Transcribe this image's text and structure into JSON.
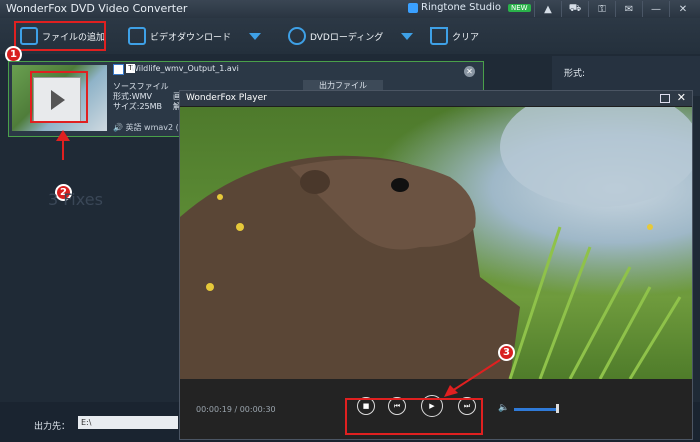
{
  "app": {
    "title": "WonderFox DVD Video Converter",
    "ringtone": "Ringtone Studio",
    "new_badge": "NEW"
  },
  "titlebar_icons": [
    "up-icon",
    "cart-icon",
    "key-icon",
    "comment-icon",
    "minimize-icon",
    "close-icon"
  ],
  "toolbar": {
    "add_file": "ファイルの追加",
    "video_download": "ビデオダウンロード",
    "dvd_loading": "DVDローディング",
    "clear": "クリア"
  },
  "file": {
    "name": "Wildlife_wmv_Output_1.avi",
    "source_label": "ソースファイル",
    "format": "形式:WMV",
    "size": "サイズ:25MB",
    "audio": "英語 wmav2 (",
    "output_label": "出力ファイル",
    "col_a": "画",
    "col_b": "解"
  },
  "right_panel": {
    "format_label": "形式:"
  },
  "bottom": {
    "output_label": "出力先：",
    "output_path": "E:\\"
  },
  "player": {
    "title": "WonderFox Player",
    "time": "00:00:19 / 00:00:30",
    "volume": 0.78
  },
  "markers": [
    "1",
    "2",
    "3"
  ],
  "watermark": "3 Fixes"
}
